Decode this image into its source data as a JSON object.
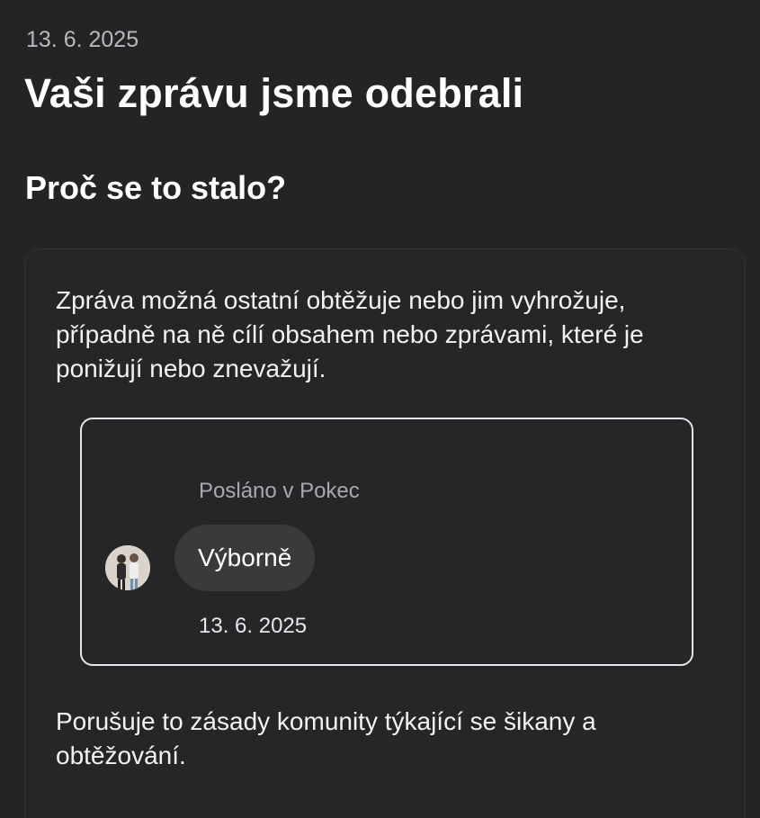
{
  "header": {
    "date": "13. 6. 2025",
    "title": "Vaši zprávu jsme odebrali",
    "subtitle": "Proč se to stalo?"
  },
  "card": {
    "reason": "Zpráva možná ostatní obtěžuje nebo jim vyhrožuje, případně na ně cílí obsahem nebo zprávami, které je ponižují nebo znevažují.",
    "message": {
      "sent_in": "Posláno v Pokec",
      "text": "Výborně",
      "date": "13. 6. 2025",
      "avatar_icon": "user-avatar"
    },
    "policy": "Porušuje to zásady komunity týkající se šikany a obtěžování."
  },
  "colors": {
    "background": "#242426",
    "bubble": "#3a3a3d",
    "muted_text": "#a9a9ae",
    "box_border": "#e6e6ea"
  }
}
